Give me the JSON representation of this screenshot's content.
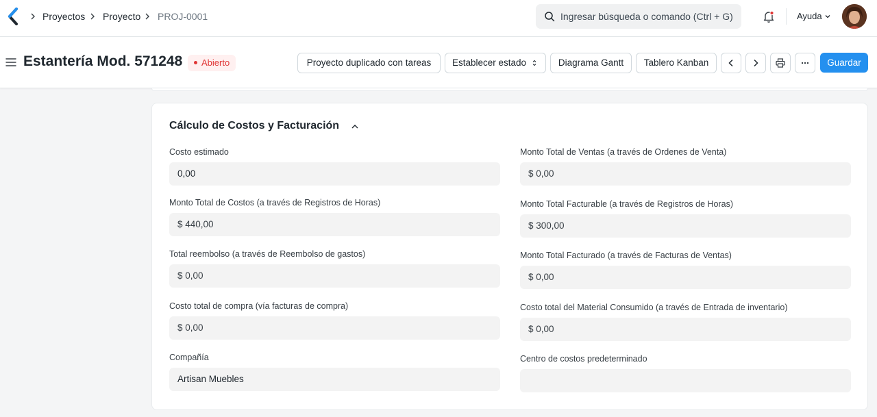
{
  "navbar": {
    "breadcrumbs": [
      "Proyectos",
      "Proyecto",
      "PROJ-0001"
    ],
    "search_placeholder": "Ingresar búsqueda o comando (Ctrl + G)",
    "help_label": "Ayuda"
  },
  "header": {
    "title": "Estantería Mod. 571248",
    "status": "Abierto",
    "buttons": {
      "duplicate": "Proyecto duplicado con tareas",
      "set_status": "Establecer estado",
      "gantt": "Diagrama Gantt",
      "kanban": "Tablero Kanban",
      "save": "Guardar"
    }
  },
  "section": {
    "title": "Cálculo de Costos y Facturación",
    "left_fields": [
      {
        "label": "Costo estimado",
        "value": "0,00"
      },
      {
        "label": "Monto Total de Costos (a través de Registros de Horas)",
        "value": "$ 440,00"
      },
      {
        "label": "Total reembolso (a través de Reembolso de gastos)",
        "value": "$ 0,00"
      },
      {
        "label": "Costo total de compra (vía facturas de compra)",
        "value": "$ 0,00"
      },
      {
        "label": "Compañía",
        "value": "Artisan Muebles"
      }
    ],
    "right_fields": [
      {
        "label": "Monto Total de Ventas (a través de Ordenes de Venta)",
        "value": "$ 0,00"
      },
      {
        "label": "Monto Total Facturable (a través de Registros de Horas)",
        "value": "$ 300,00"
      },
      {
        "label": "Monto Total Facturado (a través de Facturas de Ventas)",
        "value": "$ 0,00"
      },
      {
        "label": "Costo total del Material Consumido (a través de Entrada de inventario)",
        "value": "$ 0,00"
      },
      {
        "label": "Centro de costos predeterminado",
        "value": ""
      }
    ]
  },
  "colors": {
    "primary": "#2490ef",
    "status_red": "#e03636",
    "status_bg": "#fff0f0",
    "field_bg": "#f3f3f3"
  },
  "icons": [
    "app-logo-icon",
    "chevron-right-icon",
    "search-icon",
    "bell-icon",
    "chevron-down-icon",
    "hamburger-icon",
    "sort-icon",
    "chevron-left-icon",
    "printer-icon",
    "more-icon",
    "chevron-up-icon"
  ]
}
